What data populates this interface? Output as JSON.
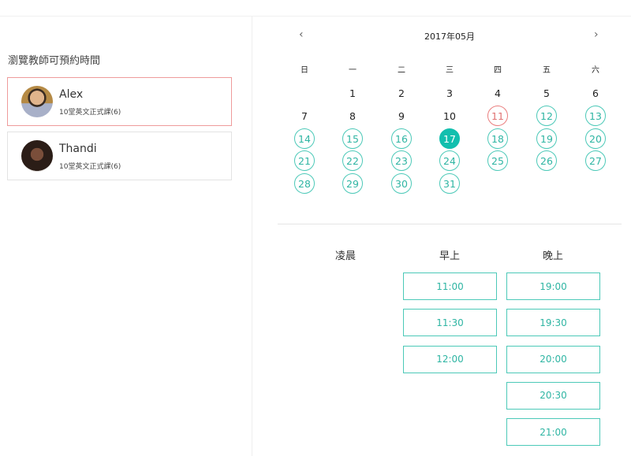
{
  "sidebar": {
    "title": "瀏覽教師可預約時間",
    "teachers": [
      {
        "name": "Alex",
        "course": "10堂英文正式課(6)"
      },
      {
        "name": "Thandi",
        "course": "10堂英文正式課(6)"
      }
    ]
  },
  "calendar": {
    "title": "2017年05月",
    "prev": "‹",
    "next": "›",
    "weekdays": [
      "日",
      "一",
      "二",
      "三",
      "四",
      "五",
      "六"
    ],
    "first_weekday": 1,
    "days_in_month": 31,
    "today": 11,
    "selected": 17,
    "available": [
      12,
      13,
      14,
      15,
      16,
      18,
      19,
      20,
      21,
      22,
      23,
      24,
      25,
      26,
      27,
      28,
      29,
      30,
      31
    ]
  },
  "times": {
    "periods": [
      "凌晨",
      "早上",
      "晚上"
    ],
    "slots": [
      [],
      [
        "11:00",
        "11:30",
        "12:00"
      ],
      [
        "19:00",
        "19:30",
        "20:00",
        "20:30",
        "21:00"
      ]
    ]
  },
  "colors": {
    "accent": "#12bfae",
    "today": "#ea7e7e"
  }
}
